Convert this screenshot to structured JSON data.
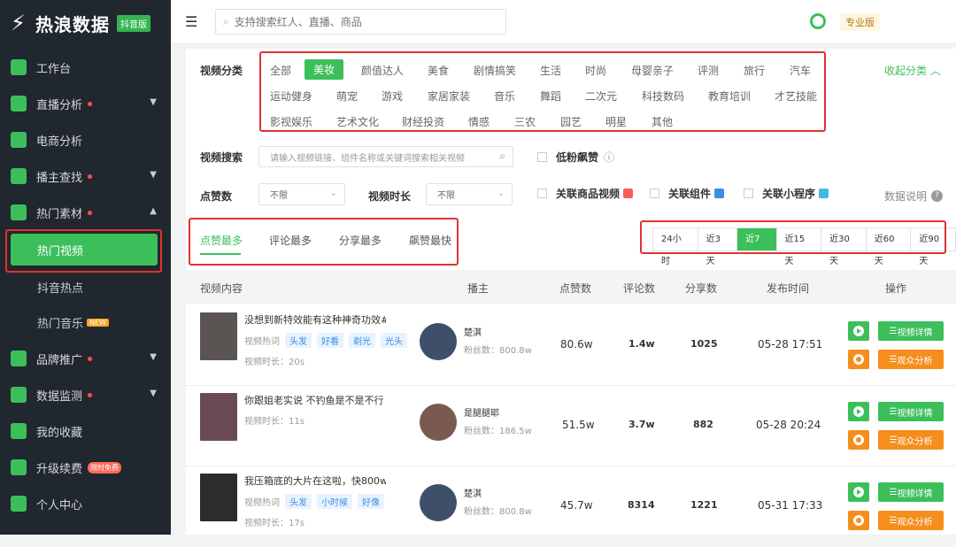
{
  "app": {
    "name": "热浪数据",
    "badge": "抖音版"
  },
  "sidebar": {
    "items": [
      {
        "label": "工作台"
      },
      {
        "label": "直播分析"
      },
      {
        "label": "电商分析"
      },
      {
        "label": "播主查找"
      },
      {
        "label": "热门素材"
      },
      {
        "label": "品牌推广"
      },
      {
        "label": "数据监测"
      },
      {
        "label": "我的收藏"
      },
      {
        "label": "升级续费"
      },
      {
        "label": "个人中心"
      }
    ],
    "sub_items": [
      {
        "label": "热门视频"
      },
      {
        "label": "抖音热点"
      },
      {
        "label": "热门音乐",
        "badge": "NEW"
      }
    ],
    "upgrade_badge": "限时免费"
  },
  "topbar": {
    "search_placeholder": "支持搜索红人、直播、商品",
    "plan": "专业版"
  },
  "filters": {
    "category_label": "视频分类",
    "collapse_label": "收起分类",
    "categories": [
      [
        "全部",
        "美妆",
        "颜值达人",
        "美食",
        "剧情搞笑",
        "生活",
        "时尚",
        "母婴亲子",
        "评测",
        "旅行",
        "汽车"
      ],
      [
        "运动健身",
        "萌宠",
        "游戏",
        "家居家装",
        "音乐",
        "舞蹈",
        "二次元",
        "科技数码",
        "教育培训",
        "才艺技能"
      ],
      [
        "影视娱乐",
        "艺术文化",
        "财经投资",
        "情感",
        "三农",
        "园艺",
        "明星",
        "其他"
      ]
    ],
    "active_category": "美妆",
    "search_label": "视频搜索",
    "search_placeholder": "请输入视频链接、组件名称或关键词搜索相关视频",
    "low_fans": "低粉飙赞",
    "likes_label": "点赞数",
    "likes_value": "不限",
    "duration_label": "视频时长",
    "duration_value": "不限",
    "link_product": "关联商品视频",
    "link_component": "关联组件",
    "link_miniapp": "关联小程序",
    "help_label": "数据说明"
  },
  "tabs": [
    "点赞最多",
    "评论最多",
    "分享最多",
    "飙赞最快"
  ],
  "ranges": [
    "24小时",
    "近3天",
    "近7天",
    "近15天",
    "近30天",
    "近60天",
    "近90天"
  ],
  "active_range": "近7天",
  "table": {
    "headers": [
      "视频内容",
      "播主",
      "点赞数",
      "评论数",
      "分享数",
      "发布时间",
      "操作"
    ],
    "rows": [
      {
        "title": "没想到新特效能有这种神奇功效#...",
        "hot_label": "视频热词",
        "tags": [
          "头发",
          "好看",
          "剃光",
          "光头"
        ],
        "duration": "视频时长：20s",
        "author": "楚淇",
        "fans": "粉丝数：800.8w",
        "likes": "80.6w",
        "comments": "1.4w",
        "shares": "1025",
        "time": "05-28 17:51"
      },
      {
        "title": "你跟姐老实说 不钓鱼是不是不行",
        "hot_label": "",
        "tags": [],
        "duration": "视频时长：11s",
        "author": "是腿腿耶",
        "fans": "粉丝数：186.5w",
        "likes": "51.5w",
        "comments": "3.7w",
        "shares": "882",
        "time": "05-28 20:24"
      },
      {
        "title": "我压箱底的大片在这啦，快800w...",
        "hot_label": "视频热词",
        "tags": [
          "头发",
          "小时候",
          "好像"
        ],
        "duration": "视频时长：17s",
        "author": "楚淇",
        "fans": "粉丝数：800.8w",
        "likes": "45.7w",
        "comments": "8314",
        "shares": "1221",
        "time": "05-31 17:33"
      }
    ],
    "btn_detail": "视频详情",
    "btn_audience": "观众分析"
  }
}
